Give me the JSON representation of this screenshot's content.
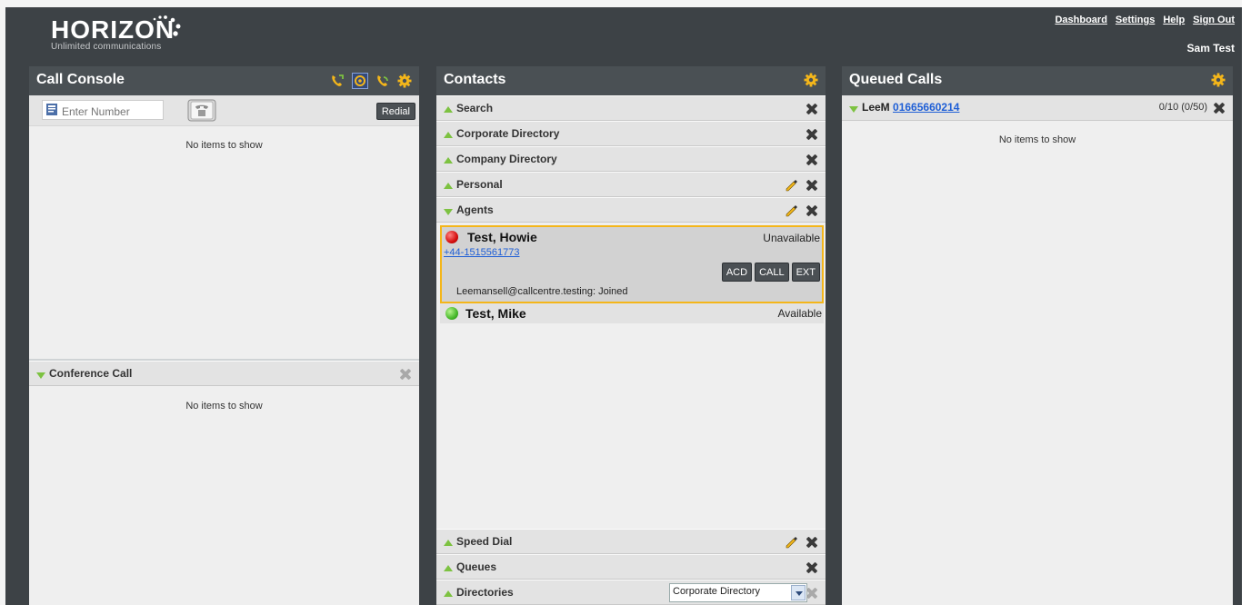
{
  "header": {
    "logo": "HORIZON",
    "tagline": "Unlimited communications",
    "links": [
      "Dashboard",
      "Settings",
      "Help",
      "Sign Out"
    ],
    "user": "Sam Test"
  },
  "console": {
    "title": "Call Console",
    "number_placeholder": "Enter Number",
    "redial_label": "Redial",
    "empty": "No items to show",
    "conference": {
      "title": "Conference Call",
      "empty": "No items to show"
    }
  },
  "contacts": {
    "title": "Contacts",
    "sections": {
      "search": "Search",
      "corporate": "Corporate Directory",
      "company": "Company Directory",
      "personal": "Personal",
      "agents": "Agents",
      "speed_dial": "Speed Dial",
      "queues": "Queues",
      "directories": "Directories"
    },
    "agents": [
      {
        "name": "Test, Howie",
        "status": "Unavailable",
        "phone": "+44-1515561773",
        "buttons": [
          "ACD",
          "CALL",
          "EXT"
        ],
        "joined": "Leemansell@callcentre.testing: Joined"
      },
      {
        "name": "Test, Mike",
        "status": "Available"
      }
    ],
    "directory_select": "Corporate Directory"
  },
  "queued": {
    "title": "Queued Calls",
    "queue_name": "LeeM",
    "queue_number": "01665660214",
    "count": "0/10 (0/50)",
    "empty": "No items to show"
  },
  "colors": {
    "background": "#3d4246",
    "panel_title": "#4a5054",
    "accent_gear": "#f4b61a",
    "highlight_border": "#f4b61a",
    "triangle": "#7dc241",
    "link": "#1f5fd6"
  }
}
